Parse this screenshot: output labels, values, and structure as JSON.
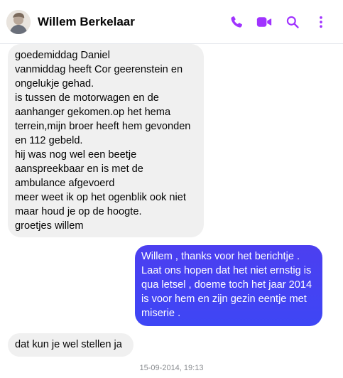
{
  "header": {
    "contact_name": "Willem Berkelaar",
    "accent_color": "#a033ff",
    "icons": [
      "phone-icon",
      "video-call-icon",
      "search-icon",
      "more-options-icon"
    ]
  },
  "messages": [
    {
      "direction": "incoming",
      "text": "goedemiddag Daniel\nvanmiddag heeft  Cor geerenstein en ongelukje gehad.\nis tussen de motorwagen en de aanhanger gekomen.op het hema terrein,mijn broer heeft hem gevonden en 112 gebeld.\nhij was nog wel een beetje aanspreekbaar en is met de ambulance afgevoerd\nmeer weet ik op het ogenblik ook niet maar houd je op de hoogte.\ngroetjes willem"
    },
    {
      "direction": "outgoing",
      "text": "Willem , thanks voor het berichtje .\nLaat ons hopen dat het niet ernstig is qua letsel , doeme toch het jaar 2014 is voor hem en zijn gezin eentje met miserie ."
    },
    {
      "direction": "incoming",
      "text": "dat kun je wel stellen ja"
    }
  ],
  "timestamp": "15-09-2014, 19:13",
  "colors": {
    "incoming_bubble": "#f0f0f0",
    "outgoing_bubble": "#4042f2",
    "timestamp_text": "#8a8d91"
  }
}
